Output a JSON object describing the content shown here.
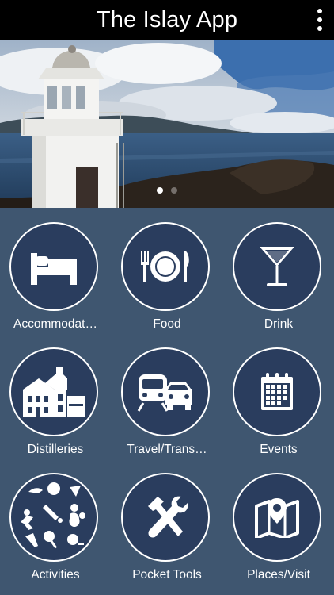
{
  "header": {
    "title": "The Islay App",
    "menu_icon": "more-vertical-icon"
  },
  "hero": {
    "image_subject": "lighthouse-by-the-sea",
    "slides": 2,
    "active_slide": 1
  },
  "tiles": [
    {
      "label": "Accommodat…",
      "icon": "bed-icon"
    },
    {
      "label": "Food",
      "icon": "plate-cutlery-icon"
    },
    {
      "label": "Drink",
      "icon": "cocktail-glass-icon"
    },
    {
      "label": "Distilleries",
      "icon": "distillery-building-icon"
    },
    {
      "label": "Travel/Trans…",
      "icon": "train-car-icon"
    },
    {
      "label": "Events",
      "icon": "calendar-icon"
    },
    {
      "label": "Activities",
      "icon": "sports-icon"
    },
    {
      "label": "Pocket Tools",
      "icon": "hammer-wrench-icon"
    },
    {
      "label": "Places/Visit",
      "icon": "map-pin-icon"
    }
  ],
  "colors": {
    "background": "#3f5670",
    "circle_fill": "#2a3d5e",
    "top_bar": "#000000",
    "text": "#ffffff"
  }
}
